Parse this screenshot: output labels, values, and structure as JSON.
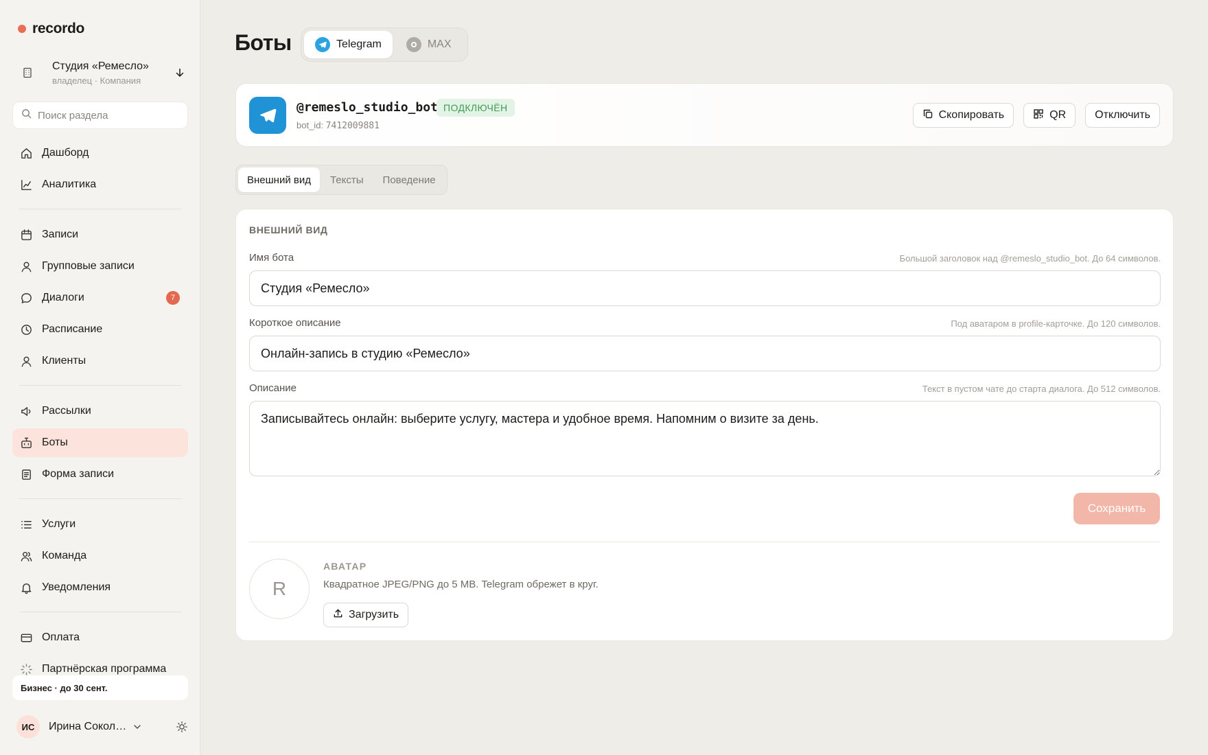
{
  "brand": {
    "name": "recordo",
    "accent": "#ea6e55"
  },
  "org": {
    "name": "Студия «Ремесло»",
    "role": "владелец · Компания"
  },
  "search": {
    "placeholder": "Поиск раздела"
  },
  "nav": {
    "items": [
      {
        "label": "Дашборд",
        "icon": "home-icon"
      },
      {
        "label": "Аналитика",
        "icon": "chart-line-icon"
      },
      {
        "label": "Записи",
        "icon": "calendar-icon"
      },
      {
        "label": "Групповые записи",
        "icon": "user-icon"
      },
      {
        "label": "Диалоги",
        "icon": "chat-bubble-icon",
        "badge": "7"
      },
      {
        "label": "Расписание",
        "icon": "clock-icon"
      },
      {
        "label": "Клиенты",
        "icon": "user-icon"
      },
      {
        "label": "Рассылки",
        "icon": "megaphone-icon"
      },
      {
        "label": "Боты",
        "icon": "bot-icon",
        "active": true
      },
      {
        "label": "Форма записи",
        "icon": "form-icon"
      },
      {
        "label": "Услуги",
        "icon": "list-icon"
      },
      {
        "label": "Команда",
        "icon": "users-icon"
      },
      {
        "label": "Уведомления",
        "icon": "bell-icon"
      },
      {
        "label": "Оплата",
        "icon": "credit-card-icon"
      },
      {
        "label": "Партнёрская программа",
        "icon": "sparkle-icon"
      }
    ]
  },
  "plan": {
    "label": "Бизнес · до 30 сент."
  },
  "user": {
    "initials": "ИС",
    "name": "Ирина Соколова"
  },
  "page": {
    "title": "Боты"
  },
  "platform_tabs": [
    {
      "label": "Telegram",
      "icon": "telegram-icon",
      "active": true
    },
    {
      "label": "MAX",
      "icon": "max-icon",
      "active": false
    }
  ],
  "bot": {
    "handle": "@remeslo_studio_bot",
    "status": "ПОДКЛЮЧЁН",
    "id_label": "bot_id:",
    "id_value": "7412009881",
    "actions": {
      "copy": "Скопировать",
      "qr": "QR",
      "disconnect": "Отключить"
    }
  },
  "sub_tabs": [
    {
      "label": "Внешний вид",
      "active": true
    },
    {
      "label": "Тексты",
      "active": false
    },
    {
      "label": "Поведение",
      "active": false
    }
  ],
  "form": {
    "section_title": "ВНЕШНИЙ ВИД",
    "name": {
      "label": "Имя бота",
      "hint": "Большой заголовок над @remeslo_studio_bot. До 64 символов.",
      "value": "Студия «Ремесло»"
    },
    "short_description": {
      "label": "Короткое описание",
      "hint": "Под аватаром в profile-карточке. До 120 символов.",
      "value": "Онлайн-запись в студию «Ремесло»"
    },
    "description": {
      "label": "Описание",
      "hint": "Текст в пустом чате до старта диалога. До 512 символов.",
      "value": "Записывайтесь онлайн: выберите услугу, мастера и удобное время. Напомним о визите за день."
    },
    "save_label": "Сохранить"
  },
  "avatar": {
    "letter": "R",
    "title": "АВАТАР",
    "description": "Квадратное JPEG/PNG до 5 MB. Telegram обрежет в круг.",
    "upload_label": "Загрузить"
  }
}
